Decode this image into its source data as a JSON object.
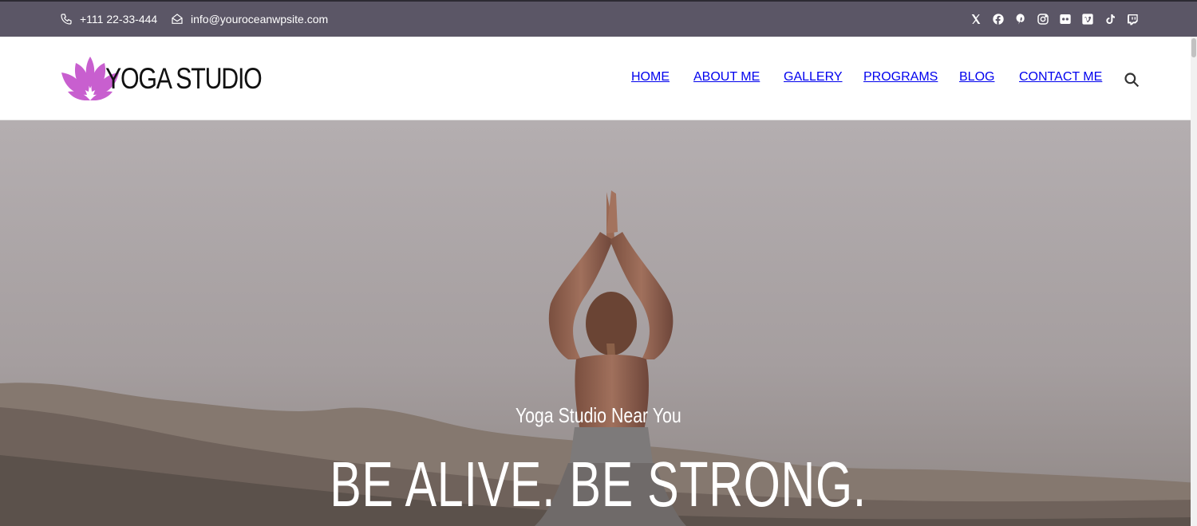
{
  "topbar": {
    "phone": "+111 22-33-444",
    "email": "info@youroceanwpsite.com",
    "background_color": "#5b5666",
    "social_icons": [
      "x-icon",
      "facebook-icon",
      "pinterest-icon",
      "instagram-icon",
      "flickr-icon",
      "vimeo-icon",
      "tiktok-icon",
      "twitch-icon"
    ]
  },
  "header": {
    "logo_text": "YOGA STUDIO",
    "logo_color": "#c85fcf",
    "nav": [
      {
        "label": "HOME"
      },
      {
        "label": "ABOUT ME"
      },
      {
        "label": "GALLERY"
      },
      {
        "label": "PROGRAMS"
      },
      {
        "label": "BLOG"
      },
      {
        "label": "CONTACT ME"
      }
    ]
  },
  "hero": {
    "subtitle": "Yoga Studio Near You",
    "headline": "BE ALIVE. BE STRONG."
  }
}
